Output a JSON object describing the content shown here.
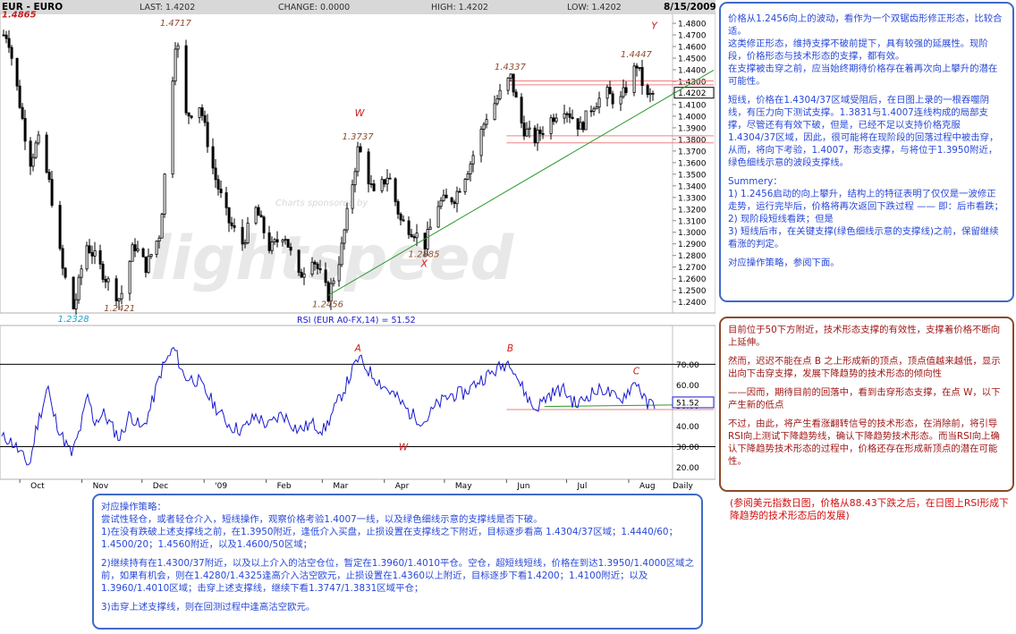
{
  "header": {
    "symbol": "EUR - EURO",
    "last": "LAST: 1.4202",
    "change": "CHANGE: 0.0000",
    "high": "HIGH: 1.4202",
    "low": "LOW: 1.4202",
    "date": "8/15/2009"
  },
  "watermark": {
    "sponsor": "Charts sponsored by",
    "brand": "lightspeed"
  },
  "chart_data": [
    {
      "type": "candlestick",
      "title": "EUR - EURO",
      "instrument": "EUR/USD",
      "interval": "Daily",
      "x_range": [
        "2008-09-25",
        "2009-08-14"
      ],
      "ylim": [
        1.232,
        1.487
      ],
      "y_ticks": [
        "1.4800",
        "1.4700",
        "1.4600",
        "1.4500",
        "1.4400",
        "1.4300",
        "1.4202",
        "1.4100",
        "1.4000",
        "1.3900",
        "1.3800",
        "1.3700",
        "1.3600",
        "1.3500",
        "1.3400",
        "1.3300",
        "1.3200",
        "1.3100",
        "1.3000",
        "1.2900",
        "1.2800",
        "1.2700",
        "1.2600",
        "1.2500",
        "1.2400"
      ],
      "x_ticks": [
        "Oct",
        "Nov",
        "Dec",
        "'09",
        "Feb",
        "Mar",
        "Apr",
        "May",
        "Jun",
        "Jul",
        "Aug",
        "Daily"
      ],
      "last_price": 1.4202,
      "path_points": [
        [
          "2008-09-25",
          1.47
        ],
        [
          "2008-09-30",
          1.42
        ],
        [
          "2008-10-06",
          1.36
        ],
        [
          "2008-10-10",
          1.38
        ],
        [
          "2008-10-16",
          1.34
        ],
        [
          "2008-10-22",
          1.27
        ],
        [
          "2008-10-28",
          1.2328
        ],
        [
          "2008-11-03",
          1.29
        ],
        [
          "2008-11-07",
          1.28
        ],
        [
          "2008-11-13",
          1.26
        ],
        [
          "2008-11-20",
          1.2421
        ],
        [
          "2008-11-27",
          1.29
        ],
        [
          "2008-12-03",
          1.27
        ],
        [
          "2008-12-10",
          1.3
        ],
        [
          "2008-12-18",
          1.4717
        ],
        [
          "2008-12-23",
          1.4
        ],
        [
          "2008-12-30",
          1.41
        ],
        [
          "2009-01-06",
          1.35
        ],
        [
          "2009-01-13",
          1.31
        ],
        [
          "2009-01-20",
          1.29
        ],
        [
          "2009-01-27",
          1.32
        ],
        [
          "2009-02-03",
          1.285
        ],
        [
          "2009-02-10",
          1.3
        ],
        [
          "2009-02-17",
          1.26
        ],
        [
          "2009-02-24",
          1.28
        ],
        [
          "2009-03-04",
          1.2456
        ],
        [
          "2009-03-10",
          1.28
        ],
        [
          "2009-03-19",
          1.3737
        ],
        [
          "2009-03-27",
          1.33
        ],
        [
          "2009-04-03",
          1.35
        ],
        [
          "2009-04-09",
          1.31
        ],
        [
          "2009-04-16",
          1.3
        ],
        [
          "2009-04-21",
          1.2885
        ],
        [
          "2009-04-28",
          1.325
        ],
        [
          "2009-05-06",
          1.33
        ],
        [
          "2009-05-14",
          1.36
        ],
        [
          "2009-05-22",
          1.4
        ],
        [
          "2009-06-03",
          1.4337
        ],
        [
          "2009-06-09",
          1.39
        ],
        [
          "2009-06-15",
          1.38
        ],
        [
          "2009-06-22",
          1.395
        ],
        [
          "2009-06-29",
          1.41
        ],
        [
          "2009-07-08",
          1.39
        ],
        [
          "2009-07-14",
          1.41
        ],
        [
          "2009-07-21",
          1.42
        ],
        [
          "2009-07-27",
          1.41
        ],
        [
          "2009-08-05",
          1.4447
        ],
        [
          "2009-08-10",
          1.415
        ],
        [
          "2009-08-14",
          1.4202
        ]
      ],
      "price_annotations": [
        {
          "text": "1.4865",
          "date": "2008-09-23",
          "price": 1.4865,
          "color": "#c02020",
          "style": "italic-bold"
        },
        {
          "text": "1.4717",
          "date": "2008-12-18",
          "price": 1.4717,
          "color": "#8b4c2a"
        },
        {
          "text": "1.4337",
          "date": "2009-06-03",
          "price": 1.4337,
          "color": "#8b4c2a"
        },
        {
          "text": "1.4447",
          "date": "2009-08-05",
          "price": 1.4447,
          "color": "#8b4c2a"
        },
        {
          "text": "1.3737",
          "date": "2009-03-19",
          "price": 1.3737,
          "color": "#8b4c2a"
        },
        {
          "text": "1.2885",
          "date": "2009-04-21",
          "price": 1.2885,
          "color": "#8b4c2a"
        },
        {
          "text": "1.2456",
          "date": "2009-03-04",
          "price": 1.2456,
          "color": "#8b4c2a"
        },
        {
          "text": "1.2421",
          "date": "2008-11-20",
          "price": 1.2421,
          "color": "#8b4c2a"
        },
        {
          "text": "1.2328",
          "date": "2008-10-28",
          "price": 1.2328,
          "color": "#1aa0c8"
        }
      ],
      "wave_labels": [
        {
          "text": "W",
          "date": "2009-03-19",
          "price": 1.4
        },
        {
          "text": "X",
          "date": "2009-04-21",
          "price": 1.27
        },
        {
          "text": "Y",
          "date": "2009-08-14",
          "price": 1.475
        }
      ],
      "levels": [
        {
          "price": 1.4304,
          "color": "#f08080"
        },
        {
          "price": 1.427,
          "color": "#f08080"
        },
        {
          "price": 1.3831,
          "color": "#f08080"
        },
        {
          "price": 1.377,
          "color": "#f08080"
        }
      ],
      "support_line": {
        "from": [
          "2009-03-04",
          1.2456
        ],
        "to": [
          "2009-08-14",
          1.41
        ],
        "color": "#2a9a2a"
      },
      "color": "#000000"
    },
    {
      "type": "line",
      "title": "RSI (EUR A0-FX,14) = 51.52",
      "series": [
        {
          "name": "RSI",
          "color": "#1a1ad0",
          "points": [
            [
              "2008-09-25",
              34
            ],
            [
              "2008-09-29",
              30
            ],
            [
              "2008-10-03",
              24
            ],
            [
              "2008-10-06",
              21
            ],
            [
              "2008-10-09",
              38
            ],
            [
              "2008-10-13",
              52
            ],
            [
              "2008-10-15",
              60
            ],
            [
              "2008-10-17",
              48
            ],
            [
              "2008-10-22",
              35
            ],
            [
              "2008-10-27",
              26
            ],
            [
              "2008-10-31",
              38
            ],
            [
              "2008-11-04",
              55
            ],
            [
              "2008-11-07",
              42
            ],
            [
              "2008-11-12",
              46
            ],
            [
              "2008-11-17",
              38
            ],
            [
              "2008-11-20",
              34
            ],
            [
              "2008-11-25",
              46
            ],
            [
              "2008-12-01",
              38
            ],
            [
              "2008-12-05",
              48
            ],
            [
              "2008-12-11",
              68
            ],
            [
              "2008-12-17",
              78
            ],
            [
              "2008-12-22",
              64
            ],
            [
              "2008-12-29",
              62
            ],
            [
              "2009-01-05",
              52
            ],
            [
              "2009-01-09",
              46
            ],
            [
              "2009-01-14",
              40
            ],
            [
              "2009-01-20",
              38
            ],
            [
              "2009-01-27",
              45
            ],
            [
              "2009-02-02",
              40
            ],
            [
              "2009-02-09",
              46
            ],
            [
              "2009-02-17",
              38
            ],
            [
              "2009-02-24",
              41
            ],
            [
              "2009-03-02",
              38
            ],
            [
              "2009-03-06",
              46
            ],
            [
              "2009-03-12",
              58
            ],
            [
              "2009-03-19",
              73
            ],
            [
              "2009-03-25",
              66
            ],
            [
              "2009-03-31",
              60
            ],
            [
              "2009-04-06",
              55
            ],
            [
              "2009-04-14",
              46
            ],
            [
              "2009-04-21",
              42
            ],
            [
              "2009-04-27",
              50
            ],
            [
              "2009-05-04",
              55
            ],
            [
              "2009-05-11",
              56
            ],
            [
              "2009-05-18",
              62
            ],
            [
              "2009-05-25",
              66
            ],
            [
              "2009-06-03",
              72
            ],
            [
              "2009-06-08",
              60
            ],
            [
              "2009-06-15",
              48
            ],
            [
              "2009-06-22",
              55
            ],
            [
              "2009-06-29",
              58
            ],
            [
              "2009-07-06",
              50
            ],
            [
              "2009-07-13",
              56
            ],
            [
              "2009-07-20",
              58
            ],
            [
              "2009-07-27",
              52
            ],
            [
              "2009-08-05",
              62
            ],
            [
              "2009-08-10",
              50
            ],
            [
              "2009-08-14",
              51.52
            ]
          ]
        }
      ],
      "ylim": [
        15,
        88
      ],
      "y_ticks": [
        "70.00",
        "60.00",
        "50.00",
        "40.00",
        "30.00",
        "20.00"
      ],
      "hlines": [
        70,
        30
      ],
      "current_value": "51.52",
      "labels": [
        {
          "text": "A",
          "date": "2009-03-19",
          "value": 78
        },
        {
          "text": "B",
          "date": "2009-06-03",
          "value": 78
        },
        {
          "text": "C",
          "date": "2009-08-05",
          "value": 67
        },
        {
          "text": "W",
          "date": "2009-04-10",
          "value": 30
        }
      ],
      "support_line": {
        "from": [
          "2009-06-20",
          49.5
        ],
        "to": [
          "2009-08-14",
          50.5
        ],
        "color": "#2a9a2a"
      },
      "resistance_line": {
        "from": [
          "2009-06-01",
          48
        ],
        "to": [
          "2009-08-14",
          48
        ],
        "color": "#f08080"
      }
    }
  ],
  "right_box": {
    "paragraphs": [
      "价格从1.2456向上的波动，看作为一个双锯齿形修正形态，比较合适。",
      "这类修正形态，维持支撑不破前提下，具有较强的延展性。现阶段，价格形态与技术形态的支撑，都有效。",
      "在支撑被击穿之前，应当始终期待价格存在着再次向上攀升的潜在可能性。",
      "",
      "短线，价格在1.4304/37区域受阻后，在日图上录的一根吞噬阴线，有压力向下测试支撑。1.3831与1.4007连线构成的局部支撑，尽管还有有效下破，但是，已经不足以支持价格克服1.4304/37区域，因此，很可能将在现阶段的回落过程中被击穿，从而，将向下考验，1.4007，形态支撑，与将位于1.3950附近，绿色细线示意的波段支撑线。",
      "",
      "Summery：",
      "1) 1.2456启动的向上攀升，结构上的特征表明了仅仅是一波修正走势，运行完毕后，价格将再次返回下跌过程 —— 即：后市看跌；",
      "2) 现阶段短线看跌；但是",
      "3) 短线后市，在关键支撑(绿色细线示意的支撑线)之前，保留继续看涨的判定。",
      "",
      "对应操作策略，参阅下面。"
    ]
  },
  "brown_box": {
    "paragraphs": [
      "目前位于50下方附近，技术形态支撑的有效性，支撑着价格不断向上延伸。",
      "",
      "然而，迟迟不能在点 B 之上形成新的顶点，顶点值越来越低，显示出向下击穿支撑，发展下降趋势的技术形态的倾向性",
      "",
      "——因而，期待目前的回落中，看到击穿形态支撑，在点 W，以下产生新的低点",
      "",
      "不过，由此，将产生看涨翻转信号的技术形态，在消除前，将引导RSI向上测试下降趋势线，确认下降趋势技术形态。而当RSI向上确认下降趋势技术形态的过程中，价格还存在形成新顶点的潜在可能性。"
    ]
  },
  "caption": "(参阅美元指数日图，价格从88.43下跌之后，在日图上RSI形成下降趋势的技术形态后的发展)",
  "bottom_box": {
    "paragraphs": [
      "对应操作策略：",
      "尝试性轻仓，或者轻仓介入，短线操作，观察价格考验1.4007一线，以及绿色细线示意的支撑线是否下破。",
      "1)在没有跌破上述支撑线之前，在1.3950附近，逢低介入买盘，止损设置在支撑线之下附近，目标逐步看高 1.4304/37区域；1.4440/60；1.4500/20；1.4560附近，以及1.4600/50区域；",
      "",
      "2)继续持有在1.4300/37附近，以及以上介入的沽空仓位，暂定在1.3960/1.4010平仓。空仓，超短线短线，价格在到达1.3950/1.4000区域之前，如果有机会，则在1.4280/1.4325逢高介入沽空欧元，止损设置在1.4360以上附近，目标逐步下看1.4200；1.4100附近；以及1.3960/1.4010区域；击穿上述支撑线，继续下看1.3747/1.3831区域平仓；",
      "",
      "3)击穿上述支撑线，则在回测过程中逢高沽空欧元。"
    ]
  }
}
